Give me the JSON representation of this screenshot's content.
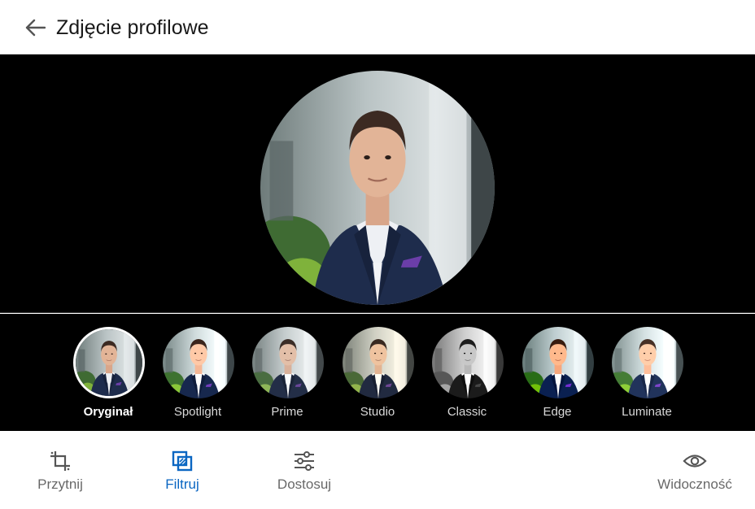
{
  "header": {
    "title": "Zdjęcie profilowe",
    "back_icon": "arrow-left-icon"
  },
  "filters": {
    "selected": "Oryginał",
    "items": [
      {
        "label": "Oryginał",
        "filter": "none"
      },
      {
        "label": "Spotlight",
        "filter": "brightness(1.08) contrast(1.1)"
      },
      {
        "label": "Prime",
        "filter": "saturate(0.75) brightness(1.05)"
      },
      {
        "label": "Studio",
        "filter": "sepia(0.25) contrast(1.05)"
      },
      {
        "label": "Classic",
        "filter": "grayscale(1) contrast(1.2)"
      },
      {
        "label": "Edge",
        "filter": "saturate(1.35) contrast(1.15)"
      },
      {
        "label": "Luminate",
        "filter": "brightness(1.15) saturate(1.1)"
      }
    ]
  },
  "toolbar": {
    "crop_label": "Przytnij",
    "crop_icon": "crop-icon",
    "filter_label": "Filtruj",
    "filter_icon": "filter-icon",
    "adjust_label": "Dostosuj",
    "adjust_icon": "sliders-icon",
    "visibility_label": "Widoczność",
    "visibility_icon": "eye-icon"
  },
  "colors": {
    "accent": "#0a66c2",
    "stage_background": "#000000",
    "label_muted": "#666666"
  }
}
